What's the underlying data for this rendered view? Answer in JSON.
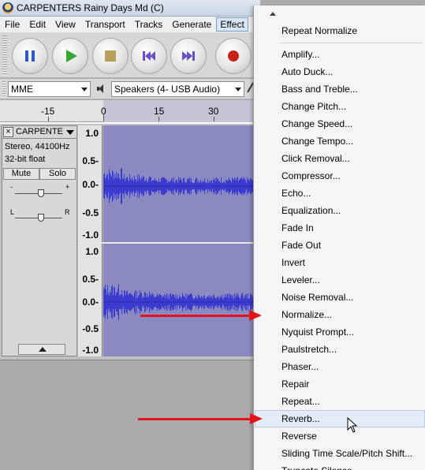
{
  "window": {
    "title": "CARPENTERS Rainy Days Md (C)"
  },
  "menubar": {
    "items": [
      {
        "label": "File"
      },
      {
        "label": "Edit"
      },
      {
        "label": "View"
      },
      {
        "label": "Transport"
      },
      {
        "label": "Tracks"
      },
      {
        "label": "Generate"
      },
      {
        "label": "Effect"
      }
    ],
    "active": "Effect"
  },
  "devices": {
    "host": "MME",
    "output": "Speakers (4- USB Audio)"
  },
  "ruler": {
    "labels": [
      "-15",
      "0",
      "15",
      "30"
    ]
  },
  "track": {
    "name": "CARPENTE",
    "info_line1": "Stereo, 44100Hz",
    "info_line2": "32-bit float",
    "mute_label": "Mute",
    "solo_label": "Solo",
    "gain_minus": "-",
    "gain_plus": "+",
    "pan_left": "L",
    "pan_right": "R"
  },
  "vruler": {
    "labels": [
      "1.0",
      "0.5-",
      "0.0-",
      "-0.5",
      "-1.0"
    ]
  },
  "effect_menu": {
    "repeat_item": "Repeat Normalize",
    "items": [
      "Amplify...",
      "Auto Duck...",
      "Bass and Treble...",
      "Change Pitch...",
      "Change Speed...",
      "Change Tempo...",
      "Click Removal...",
      "Compressor...",
      "Echo...",
      "Equalization...",
      "Fade In",
      "Fade Out",
      "Invert",
      "Leveler...",
      "Noise Removal...",
      "Normalize...",
      "Nyquist Prompt...",
      "Paulstretch...",
      "Phaser...",
      "Repair",
      "Repeat...",
      "Reverb...",
      "Reverse",
      "Sliding Time Scale/Pitch Shift...",
      "Truncate Silence..."
    ],
    "highlighted": "Reverb..."
  },
  "colors": {
    "waveform": "#3b3bd0",
    "waveform_bg": "#8a8ac0",
    "arrow": "#e2141a"
  }
}
